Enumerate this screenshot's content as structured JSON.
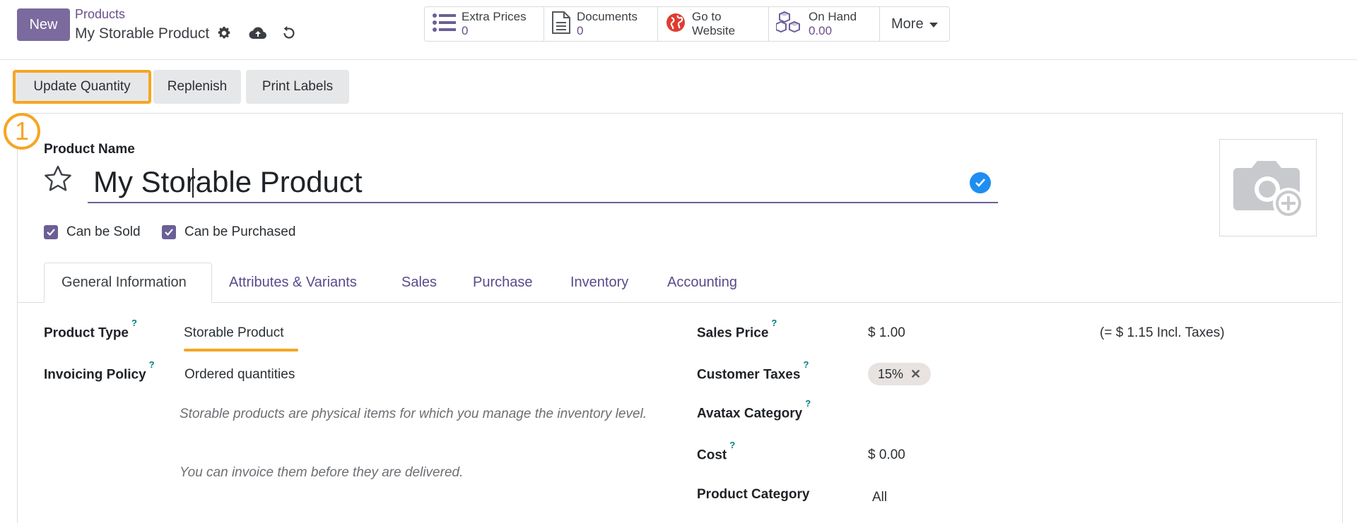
{
  "header": {
    "new_label": "New",
    "breadcrumb_parent": "Products",
    "breadcrumb_current": "My Storable Product",
    "icons": [
      "gear-icon",
      "cloud-upload-icon",
      "discard-icon"
    ]
  },
  "smart_buttons": [
    {
      "label": "Extra Prices",
      "value": "0",
      "icon": "list-icon"
    },
    {
      "label": "Documents",
      "value": "0",
      "icon": "document-icon"
    },
    {
      "label": "Go to",
      "value": "Website",
      "icon": "globe-icon"
    },
    {
      "label": "On Hand",
      "value": "0.00",
      "icon": "cubes-icon"
    }
  ],
  "more_label": "More",
  "actions": {
    "update_quantity": "Update Quantity",
    "replenish": "Replenish",
    "print_labels": "Print Labels"
  },
  "callout_number": "1",
  "form": {
    "product_name_label": "Product Name",
    "product_name_value": "My Storable Product",
    "can_be_sold": "Can be Sold",
    "can_be_purchased": "Can be Purchased"
  },
  "tabs": [
    "General Information",
    "Attributes & Variants",
    "Sales",
    "Purchase",
    "Inventory",
    "Accounting"
  ],
  "left_fields": {
    "product_type_label": "Product Type",
    "product_type_value": "Storable Product",
    "invoicing_policy_label": "Invoicing Policy",
    "invoicing_policy_value": "Ordered quantities",
    "note_1": "Storable products are physical items for which you manage the inventory level.",
    "note_2": "You can invoice them before they are delivered."
  },
  "right_fields": {
    "sales_price_label": "Sales Price",
    "sales_price_value": "$ 1.00",
    "sales_price_incl": "(= $ 1.15 Incl. Taxes)",
    "customer_taxes_label": "Customer Taxes",
    "customer_taxes_tag": "15%",
    "avatax_label": "Avatax Category",
    "cost_label": "Cost",
    "cost_value": "$ 0.00",
    "product_category_label": "Product Category",
    "product_category_value": "All"
  },
  "help_mark": "?",
  "colors": {
    "primary": "#7a6a9e",
    "link": "#6b4e8a",
    "highlight": "#f5a623",
    "check_blue": "#1f8ef1"
  }
}
